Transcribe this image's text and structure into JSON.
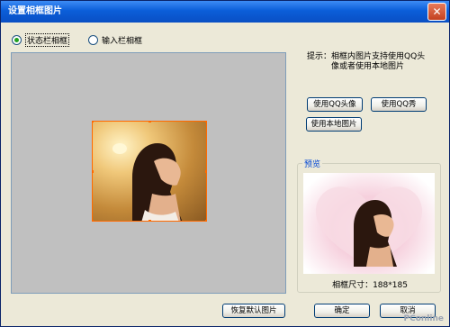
{
  "window": {
    "title": "设置相框图片",
    "close_glyph": "✕"
  },
  "mode": {
    "options": [
      {
        "label": "状态栏相框",
        "selected": true
      },
      {
        "label": "输入栏相框",
        "selected": false
      }
    ]
  },
  "hint": {
    "line1": "提示：相框内图片支持使用QQ头",
    "line2": "像或者使用本地图片"
  },
  "buttons": {
    "use_qq_avatar": "使用QQ头像",
    "use_qq_show": "使用QQ秀",
    "use_local_image": "使用本地图片",
    "restore_default": "恢复默认图片",
    "ok": "确定",
    "cancel": "取消"
  },
  "preview": {
    "title": "预览",
    "size_label": "相框尺寸：",
    "size_value": "188*185"
  },
  "watermark": "PConline",
  "colors": {
    "titlebar": "#0b5ed9",
    "selection_border": "#ff6a00",
    "preview_tint": "#f6d0dd"
  }
}
